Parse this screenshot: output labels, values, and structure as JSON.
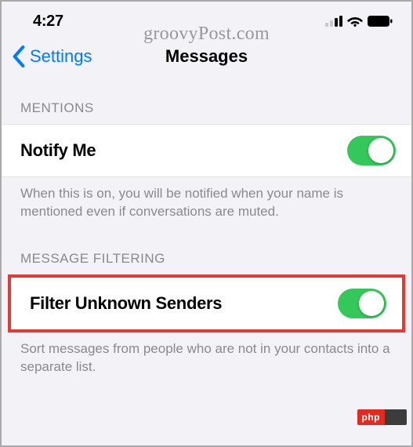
{
  "status": {
    "time": "4:27"
  },
  "watermark": "groovyPost.com",
  "nav": {
    "back_label": "Settings",
    "title": "Messages"
  },
  "sections": {
    "mentions": {
      "header": "MENTIONS",
      "row_label": "Notify Me",
      "toggle_on": true,
      "footer": "When this is on, you will be notified when your name is mentioned even if conversations are muted."
    },
    "filtering": {
      "header": "MESSAGE FILTERING",
      "row_label": "Filter Unknown Senders",
      "toggle_on": true,
      "footer": "Sort messages from people who are not in your contacts into a separate list."
    }
  },
  "badge": {
    "text": "php"
  }
}
